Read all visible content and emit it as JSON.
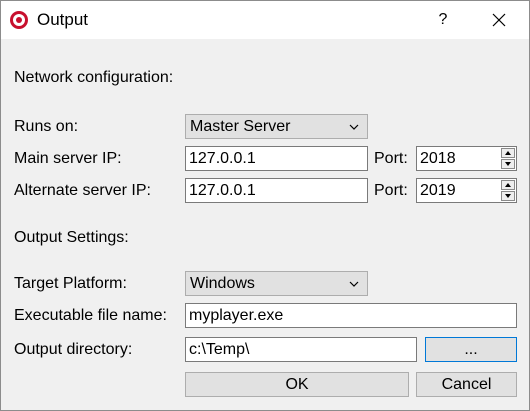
{
  "window": {
    "title": "Output",
    "help_label": "?",
    "close_icon": "close-icon",
    "app_icon": "ring-logo-icon",
    "brand_color": "#c8102e"
  },
  "network": {
    "heading": "Network configuration:",
    "runs_on_label": "Runs on:",
    "runs_on_value": "Master Server",
    "main_ip_label": "Main server IP:",
    "main_ip_value": "127.0.0.1",
    "main_port_label": "Port:",
    "main_port_value": "2018",
    "alt_ip_label": "Alternate server IP:",
    "alt_ip_value": "127.0.0.1",
    "alt_port_label": "Port:",
    "alt_port_value": "2019"
  },
  "output": {
    "heading": "Output Settings:",
    "platform_label": "Target Platform:",
    "platform_value": "Windows",
    "exe_label": "Executable file name:",
    "exe_value": "myplayer.exe",
    "dir_label": "Output directory:",
    "dir_value": "c:\\Temp\\",
    "browse_label": "..."
  },
  "actions": {
    "ok_label": "OK",
    "cancel_label": "Cancel"
  }
}
